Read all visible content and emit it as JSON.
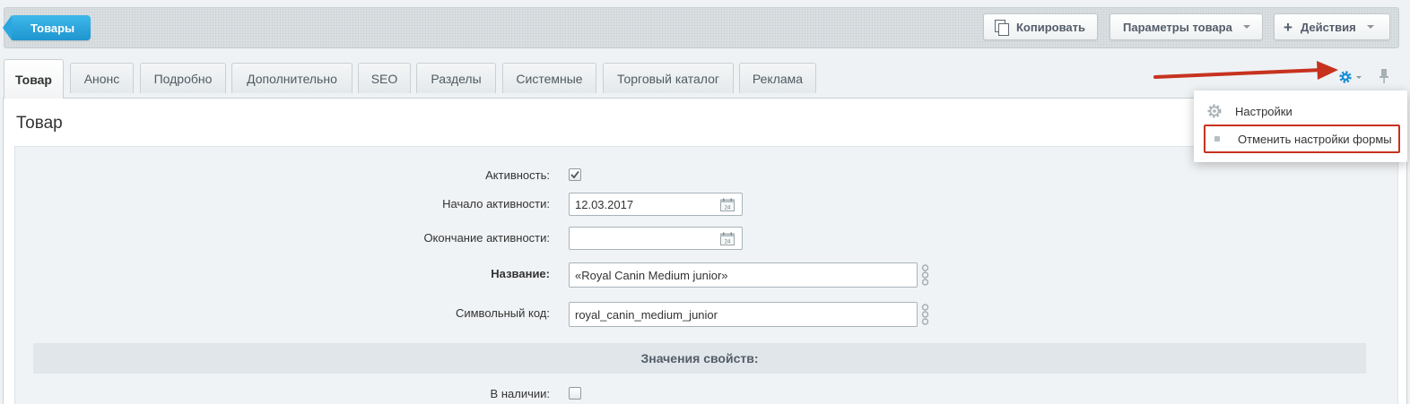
{
  "toolbar": {
    "back_label": "Товары",
    "copy_label": "Копировать",
    "params_label": "Параметры товара",
    "actions_label": "Действия",
    "actions_plus": "+"
  },
  "tabs": [
    {
      "label": "Товар",
      "active": true
    },
    {
      "label": "Анонс"
    },
    {
      "label": "Подробно"
    },
    {
      "label": "Дополнительно"
    },
    {
      "label": "SEO"
    },
    {
      "label": "Разделы"
    },
    {
      "label": "Системные"
    },
    {
      "label": "Торговый каталог"
    },
    {
      "label": "Реклама"
    }
  ],
  "settings_menu": {
    "items": [
      {
        "label": "Настройки",
        "icon": "gear-icon"
      },
      {
        "label": "Отменить настройки формы",
        "icon": "dot-icon",
        "highlighted": true
      }
    ]
  },
  "panel": {
    "title": "Товар"
  },
  "form": {
    "active_label": "Активность:",
    "active_checked": true,
    "start_label": "Начало активности:",
    "start_value": "12.03.2017",
    "end_label": "Окончание активности:",
    "end_value": "",
    "name_label": "Название:",
    "name_value": "«Royal Canin Medium junior»",
    "code_label": "Символьный код:",
    "code_value": "royal_canin_medium_junior",
    "section_label": "Значения свойств:",
    "instock_label": "В наличии:",
    "instock_checked": false,
    "calendar_day": "24"
  },
  "colors": {
    "accent_blue": "#1e95cf",
    "highlight_red": "#c7321f",
    "gear_blue": "#1b8fd6"
  }
}
